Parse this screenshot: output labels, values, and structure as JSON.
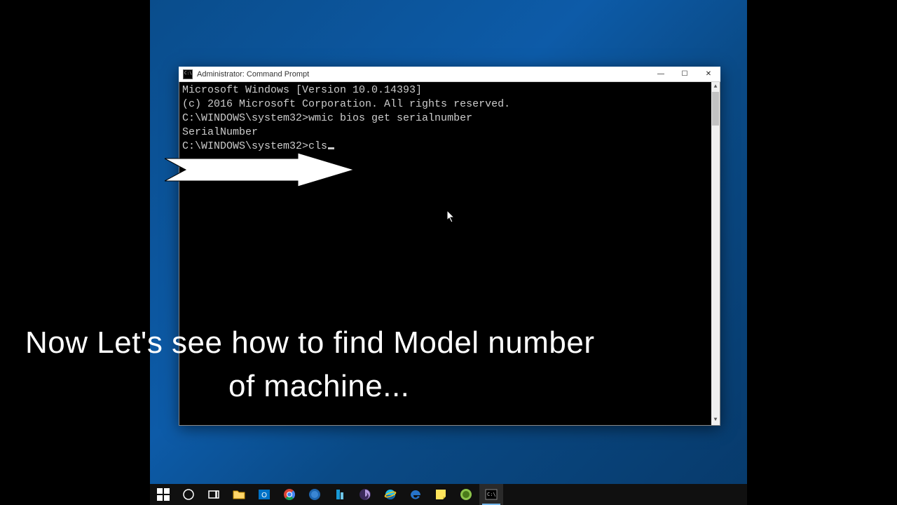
{
  "window": {
    "title": "Administrator: Command Prompt",
    "controls": {
      "min": "—",
      "max": "☐",
      "close": "✕"
    }
  },
  "terminal": {
    "line1": "Microsoft Windows [Version 10.0.14393]",
    "line2": "(c) 2016 Microsoft Corporation. All rights reserved.",
    "blank1": "",
    "prompt1": "C:\\WINDOWS\\system32>",
    "cmd1": "wmic bios get serialnumber",
    "out1": "SerialNumber",
    "blank2": "",
    "blank3": "",
    "blank4": "",
    "prompt2": "C:\\WINDOWS\\system32>",
    "cmd2": "cls"
  },
  "caption": {
    "line1": "Now Let's see how to find Model number",
    "line2": "of machine..."
  },
  "taskbar": {
    "items": [
      {
        "name": "start",
        "label": "Start"
      },
      {
        "name": "cortana",
        "label": "Cortana"
      },
      {
        "name": "taskview",
        "label": "Task View"
      },
      {
        "name": "explorer",
        "label": "File Explorer"
      },
      {
        "name": "outlook",
        "label": "Outlook"
      },
      {
        "name": "chrome",
        "label": "Chrome"
      },
      {
        "name": "app1",
        "label": "App"
      },
      {
        "name": "app2",
        "label": "App"
      },
      {
        "name": "app3",
        "label": "App"
      },
      {
        "name": "ie",
        "label": "Internet Explorer"
      },
      {
        "name": "edge",
        "label": "Edge"
      },
      {
        "name": "sticky",
        "label": "Sticky Notes"
      },
      {
        "name": "qbit",
        "label": "qBittorrent"
      },
      {
        "name": "cmd",
        "label": "Command Prompt"
      }
    ]
  }
}
